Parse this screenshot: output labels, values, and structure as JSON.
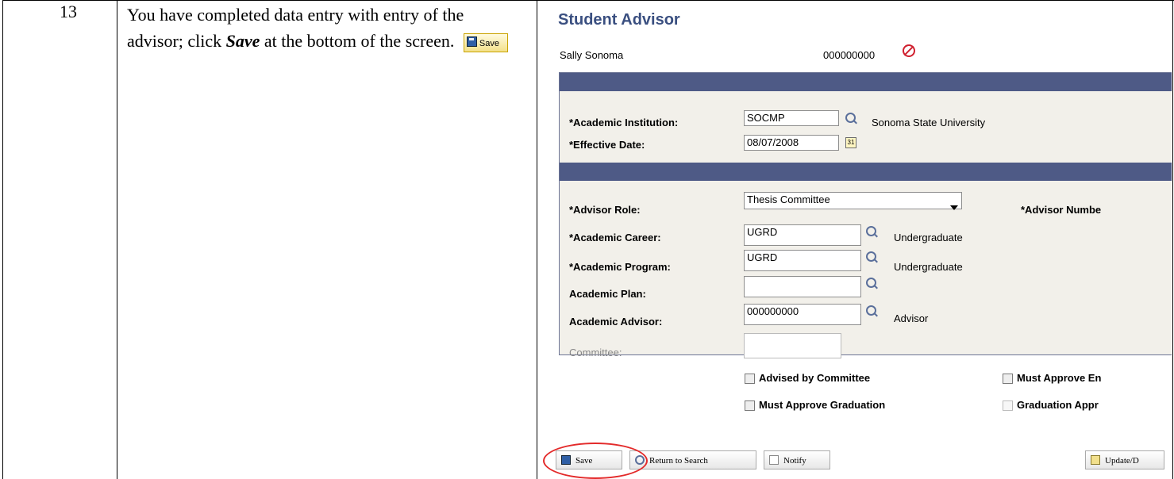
{
  "step": {
    "number": "13"
  },
  "instruction": {
    "before": "You have completed data entry with entry of the advisor; click ",
    "emphasis": "Save",
    "after": " at the bottom of the screen.",
    "inline_button_label": "Save"
  },
  "panel": {
    "title": "Student Advisor",
    "student_name": "Sally Sonoma",
    "student_id": "000000000",
    "institution": {
      "label": "*Academic Institution:",
      "value": "SOCMP",
      "description": "Sonoma State University"
    },
    "effective_date": {
      "label": "*Effective Date:",
      "value": "08/07/2008"
    },
    "advisor_role": {
      "label": "*Advisor Role:",
      "value": "Thesis Committee"
    },
    "advisor_number_label": "*Advisor Numbe",
    "career": {
      "label": "*Academic Career:",
      "value": "UGRD",
      "description": "Undergraduate"
    },
    "program": {
      "label": "*Academic Program:",
      "value": "UGRD",
      "description": "Undergraduate"
    },
    "plan": {
      "label": "Academic Plan:",
      "value": ""
    },
    "advisor": {
      "label": "Academic Advisor:",
      "value": "000000000",
      "description": "Advisor"
    },
    "committee": {
      "label": "Committee:",
      "value": ""
    },
    "checkboxes": {
      "advised_by_committee": "Advised by Committee",
      "must_approve_enrollment": "Must Approve En",
      "must_approve_graduation": "Must Approve Graduation",
      "graduation_approved": "Graduation Appr"
    },
    "buttons": {
      "save": "Save",
      "return_to_search": "Return to Search",
      "notify": "Notify",
      "update": "Update/D"
    },
    "colors": {
      "header_bar": "#4e5a86",
      "title": "#3a4f80",
      "highlight_ring": "#e32a2a"
    }
  }
}
